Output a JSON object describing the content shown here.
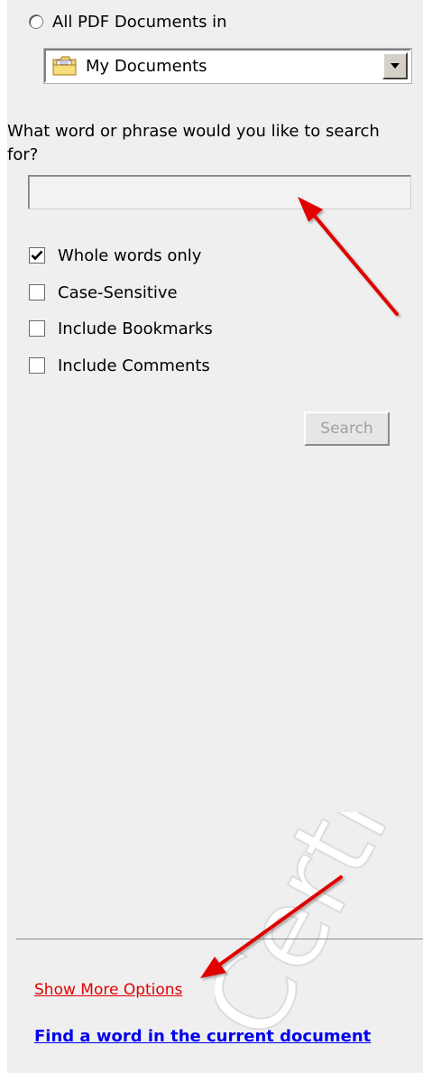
{
  "scope": {
    "radio_label": "All PDF Documents in",
    "location_value": "My Documents",
    "location_icon": "folder-icon"
  },
  "search": {
    "question": "What word or phrase would you like to search for?",
    "input_value": "",
    "button_label": "Search"
  },
  "options": [
    {
      "label": "Whole words only",
      "checked": true
    },
    {
      "label": "Case-Sensitive",
      "checked": false
    },
    {
      "label": "Include Bookmarks",
      "checked": false
    },
    {
      "label": "Include Comments",
      "checked": false
    }
  ],
  "footer": {
    "more_options_label": "Show More Options",
    "find_label": "Find a word in the current document"
  },
  "watermark": {
    "text": "Certi"
  },
  "colors": {
    "panel_background": "#efefef",
    "annotation_arrow": "#e00000",
    "more_options_link": "#e00000",
    "find_link": "#0000ee",
    "disabled_text": "#a0a0a0"
  }
}
